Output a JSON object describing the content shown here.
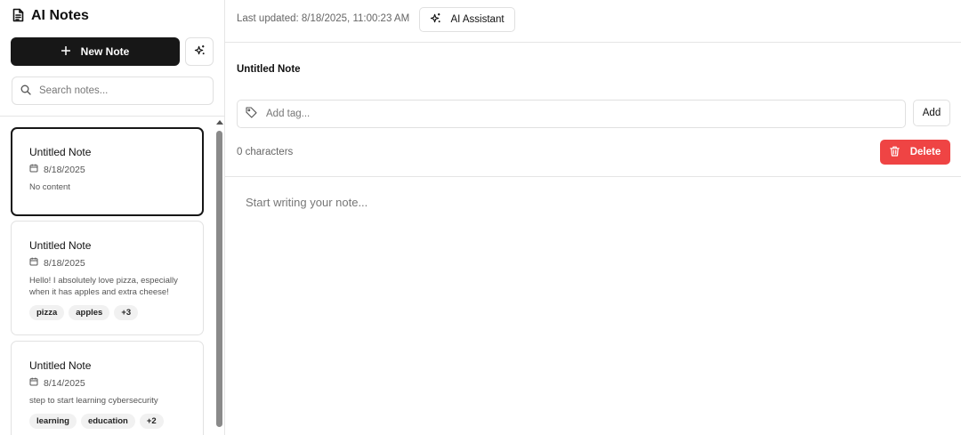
{
  "app": {
    "title": "AI Notes"
  },
  "sidebar": {
    "new_note_label": "New Note",
    "search_placeholder": "Search notes..."
  },
  "notes": [
    {
      "title": "Untitled Note",
      "date": "8/18/2025",
      "preview": "No content",
      "tags": [],
      "active": true
    },
    {
      "title": "Untitled Note",
      "date": "8/18/2025",
      "preview": "Hello! I absolutely love pizza, especially when it has apples and extra cheese!",
      "tags": [
        "pizza",
        "apples",
        "+3"
      ]
    },
    {
      "title": "Untitled Note",
      "date": "8/14/2025",
      "preview": "step to start learning cybersecurity",
      "tags": [
        "learning",
        "education",
        "+2"
      ]
    }
  ],
  "main": {
    "last_updated": "Last updated: 8/18/2025, 11:00:23 AM",
    "ai_assistant_label": "AI Assistant",
    "note_title": "Untitled Note",
    "tag_placeholder": "Add tag...",
    "add_label": "Add",
    "char_count": "0 characters",
    "delete_label": "Delete",
    "editor_placeholder": "Start writing your note..."
  },
  "colors": {
    "primary": "#171717",
    "danger": "#ef4444",
    "border": "#e5e5e5",
    "muted_text": "#666666"
  },
  "icons": {
    "title": "document-icon",
    "new": "plus-icon",
    "magic": "sparkles-icon",
    "search": "search-icon",
    "date": "calendar-icon",
    "tag": "tag-icon",
    "delete": "trash-icon"
  }
}
